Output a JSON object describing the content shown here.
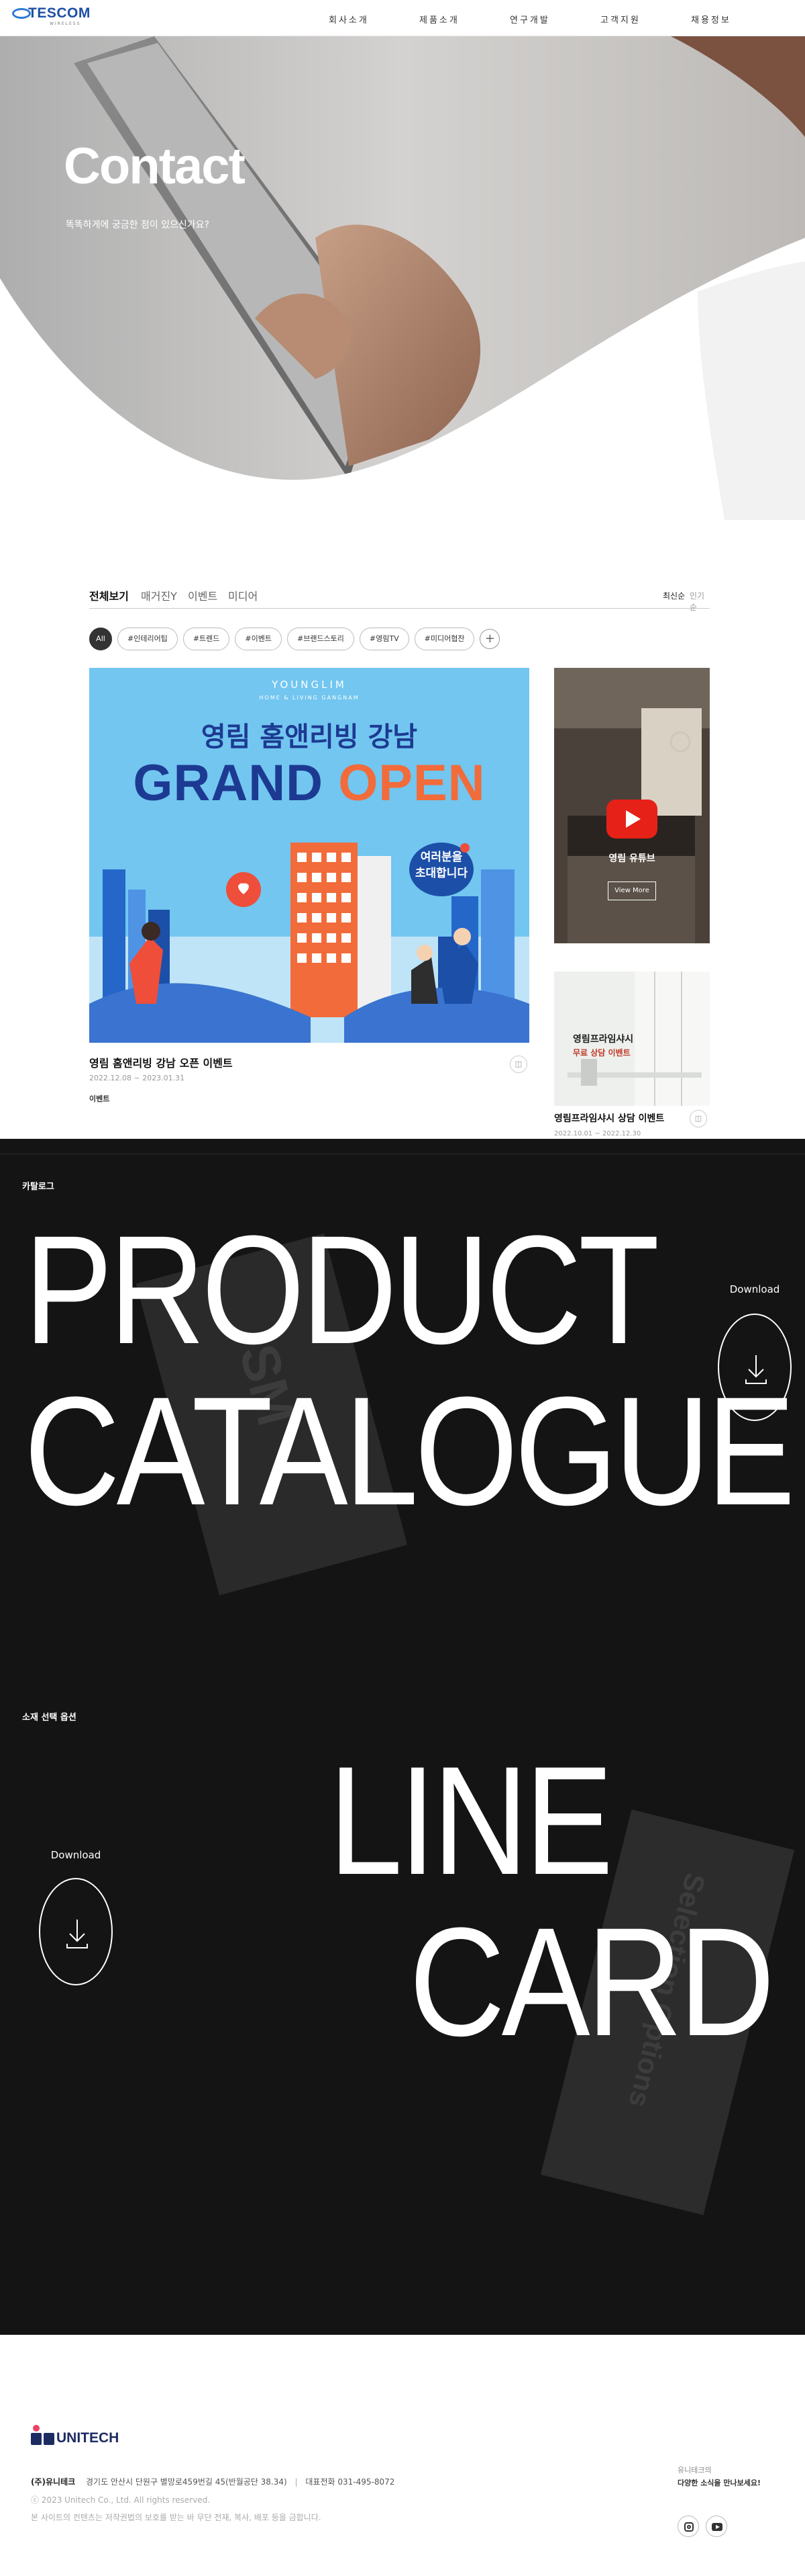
{
  "header": {
    "logo_text": "TESCOM",
    "logo_sub": "WIRELESS",
    "menu": [
      "회사소개",
      "제품소개",
      "연구개발",
      "고객지원",
      "채용정보"
    ]
  },
  "hero": {
    "title": "Contact",
    "subtitle": "똑똑하게에 궁금한 점이 있으신가요?"
  },
  "board": {
    "tabs": [
      "전체보기",
      "매거진Y",
      "이벤트",
      "미디어"
    ],
    "sort": [
      "최신순",
      "인기순"
    ],
    "chips": [
      "All",
      "#인테리어팁",
      "#트렌드",
      "#이벤트",
      "#브랜드스토리",
      "#영림TV",
      "#미디어협찬"
    ],
    "chip_more": "+",
    "main_card": {
      "brand": "YOUNGLIM",
      "brand_sub": "HOME & LIVING GANGNAM",
      "headline": "영림 홈앤리빙 강남",
      "open_word_1": "GRAND",
      "open_word_2": "OPEN",
      "bubble_line_1": "여러분을",
      "bubble_line_2": "초대합니다",
      "title": "영림 홈앤리빙 강남 오픈 이벤트",
      "date": "2022.12.08 ~ 2023.01.31",
      "category": "이벤트"
    },
    "youtube_card": {
      "title": "영림 유튜브",
      "button": "View More"
    },
    "side_card": {
      "image_line_1": "영림프라임샤시",
      "image_line_2": "무료 상담 이벤트",
      "title": "영림프라임샤시 상담 이벤트",
      "date": "2022.10.01 ~ 2022.12.30"
    }
  },
  "catalogue": {
    "label": "카탈로그",
    "line_1": "PRODUCT",
    "line_2": "CATALOGUE",
    "download": "Download"
  },
  "linecard": {
    "label": "소재 선택 옵션",
    "line_1": "LINE",
    "line_2": "CARD",
    "download": "Download"
  },
  "footer": {
    "brand": "UNITECH",
    "company": "(주)유니테크",
    "address": "경기도 안산시 단원구 별망로459번길 45(반월공단 38.34)",
    "tel": "대표전화 031-495-8072",
    "copyright": "ⓒ 2023 Unitech Co., Ltd. All rights reserved.",
    "notice": "본 사이트의 컨텐츠는 저작권법의 보호를 받는 바 무단 전재, 복사, 배포 등을 금합니다.",
    "family_label": "유니테크의",
    "family_text": "다양한 소식을 만나보세요!"
  },
  "colors": {
    "brand_blue": "#1d4fa5",
    "hero_sky": "#6fc3ee",
    "dark_bg": "#141414",
    "youtube_red": "#e62117"
  }
}
